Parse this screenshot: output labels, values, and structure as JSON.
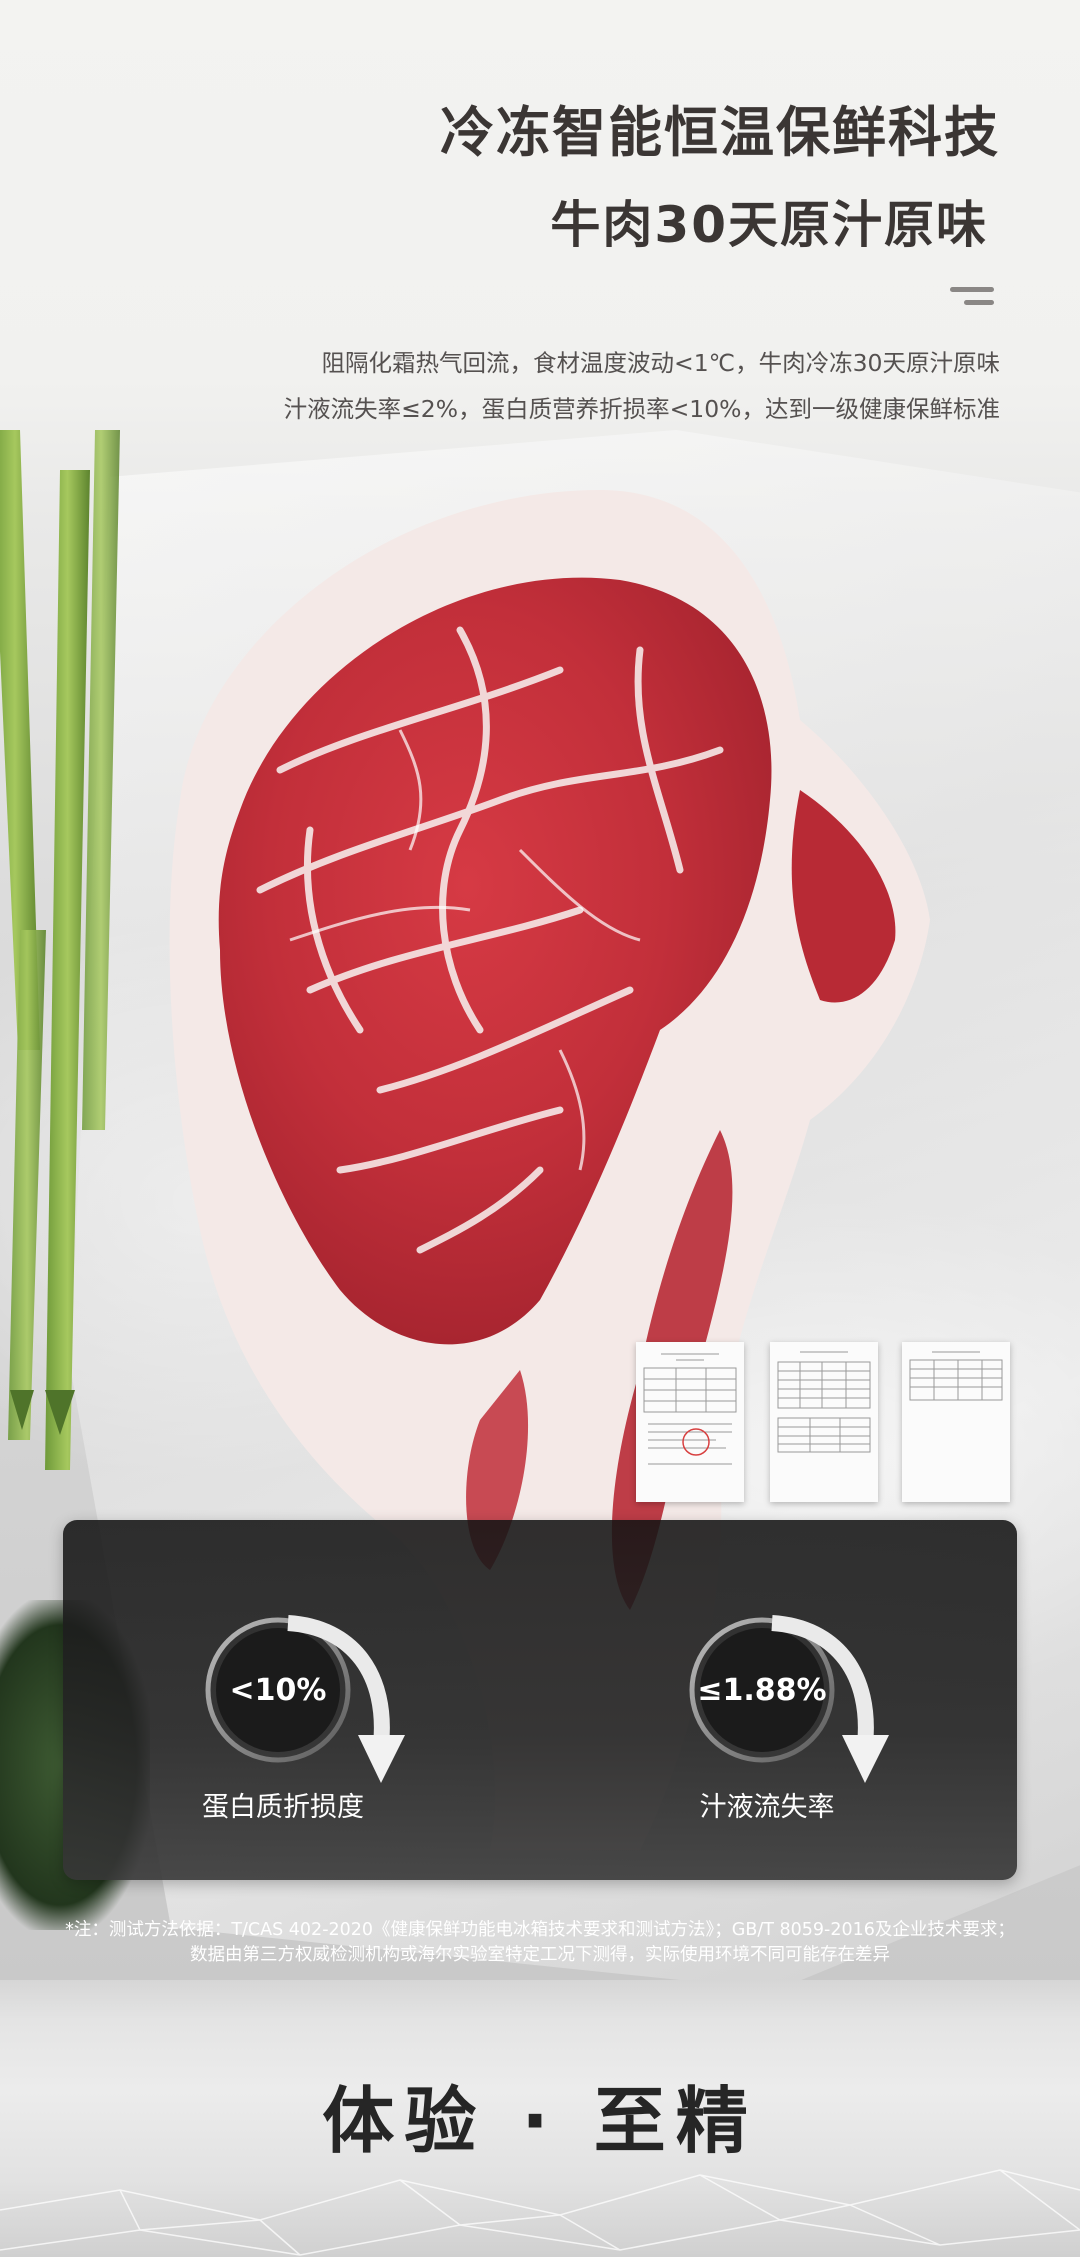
{
  "header": {
    "headline": "冷冻智能恒温保鲜科技",
    "subheadline": "牛肉30天原汁原味",
    "description_lines": [
      "阻隔化霜热气回流，食材温度波动<1℃，牛肉冷冻30天原汁原味",
      "汁液流失率≤2%，蛋白质营养折损率<10%，达到一级健康保鲜标准"
    ]
  },
  "test_reports": {
    "count": 3
  },
  "stats": [
    {
      "value": "<10%",
      "label": "蛋白质折损度"
    },
    {
      "value": "≤1.88%",
      "label": "汁液流失率"
    }
  ],
  "footnote_lines": [
    "*注：测试方法依据：T/CAS 402-2020《健康保鲜功能电冰箱技术要求和测试方法》；GB/T 8059-2016及企业技术要求；",
    "数据由第三方权威检测机构或海尔实验室特定工况下测得，实际使用环境不同可能存在差异"
  ],
  "section_title": "体验 · 至精",
  "colors": {
    "headline_text": "#3b3634",
    "panel_bg": "#1c1c1c",
    "meat_red": "#c8303a",
    "fat_white": "#f2e6e4"
  },
  "icons": [
    "down-arrow-icon"
  ]
}
